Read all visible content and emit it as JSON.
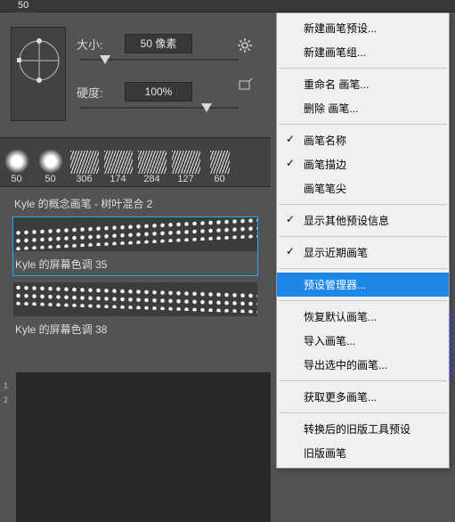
{
  "topbar": {
    "corner_value": "50"
  },
  "brush": {
    "size_label": "大小:",
    "size_value": "50 像素",
    "hardness_label": "硬度:",
    "hardness_value": "100%"
  },
  "thumbs": [
    {
      "label": "50"
    },
    {
      "label": "50"
    },
    {
      "label": "306"
    },
    {
      "label": "174"
    },
    {
      "label": "284"
    },
    {
      "label": "127"
    },
    {
      "label": "60"
    }
  ],
  "list": {
    "header": "Kyle 的概念画笔 - 树叶混合 2",
    "items": [
      {
        "name": "Kyle 的屏幕色调 35",
        "selected": true
      },
      {
        "name": "Kyle 的屏幕色调 38",
        "selected": false
      }
    ]
  },
  "ruler": {
    "marks": [
      "1",
      "2"
    ]
  },
  "menu": {
    "groups": [
      [
        {
          "label": "新建画笔预设..."
        },
        {
          "label": "新建画笔组..."
        }
      ],
      [
        {
          "label": "重命名 画笔..."
        },
        {
          "label": "删除 画笔..."
        }
      ],
      [
        {
          "label": "画笔名称",
          "checked": true
        },
        {
          "label": "画笔描边",
          "checked": true
        },
        {
          "label": "画笔笔尖"
        }
      ],
      [
        {
          "label": "显示其他预设信息",
          "checked": true
        }
      ],
      [
        {
          "label": "显示近期画笔",
          "checked": true
        }
      ],
      [
        {
          "label": "预设管理器...",
          "highlight": true
        }
      ],
      [
        {
          "label": "恢复默认画笔..."
        },
        {
          "label": "导入画笔..."
        },
        {
          "label": "导出选中的画笔..."
        }
      ],
      [
        {
          "label": "获取更多画笔..."
        }
      ],
      [
        {
          "label": "转换后的旧版工具预设"
        },
        {
          "label": "旧版画笔"
        }
      ]
    ]
  }
}
